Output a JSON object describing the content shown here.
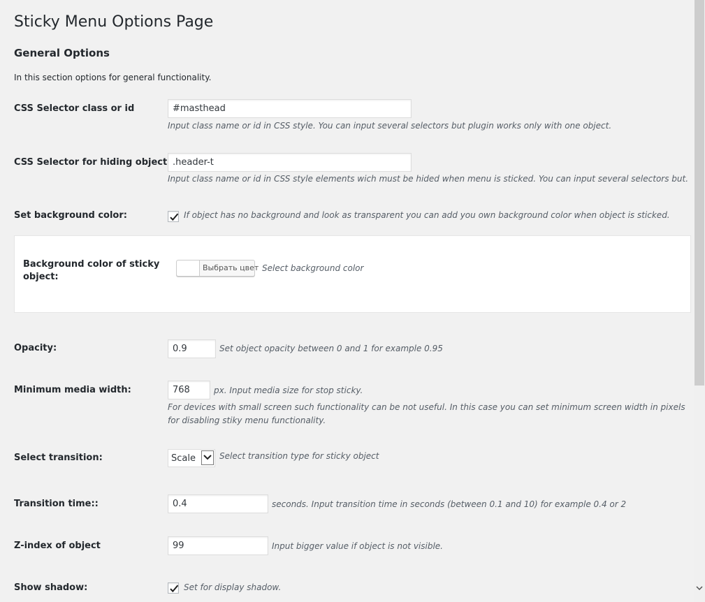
{
  "page": {
    "title": "Sticky Menu Options Page",
    "section_title": "General Options",
    "section_intro": "In this section options for general functionality."
  },
  "fields": {
    "css_selector": {
      "label": "CSS Selector class or id",
      "value": "#masthead",
      "desc": "Input class name or id in CSS style. You can input several selectors but plugin works only with one object."
    },
    "hide_selector": {
      "label": "CSS Selector for hiding objects",
      "value": ".header-t",
      "desc": "Input class name or id in CSS style elements wich must be hided when menu is sticked. You can input several selectors but."
    },
    "set_bg": {
      "label": "Set background color:",
      "checked": true,
      "desc": "If object has no background and look as transparent you can add you own background color when object is sticked."
    },
    "bg_color": {
      "label_line1": "Background color of sticky",
      "label_line2": "object:",
      "button_label": "Выбрать цвет",
      "desc": "Select background color",
      "swatch_color": "#ffffff"
    },
    "opacity": {
      "label": "Opacity:",
      "value": "0.9",
      "desc": "Set object opacity between 0 and 1 for example 0.95"
    },
    "min_width": {
      "label": "Minimum media width:",
      "value": "768",
      "desc": "px. Input media size for stop sticky.",
      "desc2_line1": "For devices with small screen such functionality can be not useful. In this case you can set minimum screen width in pixels",
      "desc2_line2": "for disabling stiky menu functionality."
    },
    "transition": {
      "label": "Select transition:",
      "value": "Scale",
      "desc": "Select transition type for sticky object"
    },
    "transition_time": {
      "label": "Transition time::",
      "value": "0.4",
      "desc": "seconds. Input transition time in seconds (between 0.1 and 10) for example 0.4 or 2"
    },
    "z_index": {
      "label": "Z-index of object",
      "value": "99",
      "desc": "Input bigger value if object is not visible."
    },
    "shadow": {
      "label": "Show shadow:",
      "checked": true,
      "desc": "Set for display shadow."
    }
  },
  "icons": {
    "checkmark": "checkmark-icon",
    "select_arrow": "chevron-down-icon",
    "scroll_down": "chevron-down-icon"
  },
  "colors": {
    "background": "#f1f1f1",
    "text": "#23282d",
    "description": "#555d66",
    "checkmark": "#1e8cbe"
  }
}
